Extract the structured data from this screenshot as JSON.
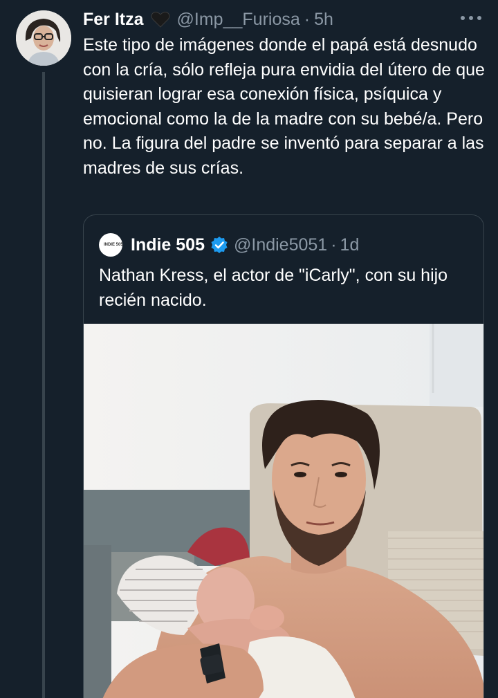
{
  "tweet": {
    "author_name": "Fer Itza",
    "author_emoji": "black-heart-icon",
    "handle": "@Imp__Furiosa",
    "separator": "·",
    "time": "5h",
    "text": "Este tipo de imágenes donde el papá está desnudo con la cría, sólo refleja pura envidia del útero de que quisieran lograr esa conexión física, psíquica y emocional como la de la madre con su bebé/a. Pero no. La figura del padre se inventó para separar a las madres de sus crías."
  },
  "quoted_tweet": {
    "avatar_text": "INDIE 505",
    "author_name": "Indie 505",
    "verified": true,
    "handle": "@Indie5051",
    "separator": "·",
    "time": "1d",
    "text": "Nathan Kress, el actor  de \"iCarly\", con su hijo recién nacido.",
    "media": "photo-man-holding-newborn"
  },
  "colors": {
    "background": "#15202b",
    "border": "#38444d",
    "secondary_text": "#8b98a5",
    "verified_blue": "#1d9bf0"
  }
}
